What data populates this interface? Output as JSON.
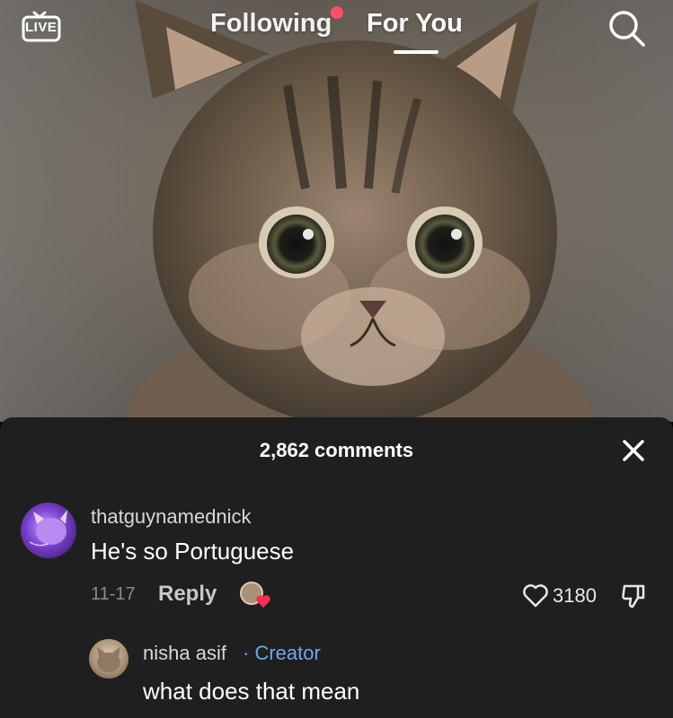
{
  "top_nav": {
    "live_label": "LIVE",
    "tabs": [
      {
        "label": "Following",
        "has_notification_dot": true
      },
      {
        "label": "For You",
        "active": true
      }
    ],
    "search_icon": "search-icon"
  },
  "comments_sheet": {
    "title": "2,862 comments",
    "close_icon": "close-icon",
    "comments": [
      {
        "username": "thatguynamednick",
        "text": "He's so Portuguese",
        "date": "11-17",
        "reply_label": "Reply",
        "like_count": "3180",
        "liked_by_creator": true
      },
      {
        "username": "nisha asif",
        "badge": "· Creator",
        "text": "what does that mean"
      }
    ]
  },
  "colors": {
    "sheet_background": "#1f1f1f",
    "notification_dot": "#fe4f6b",
    "creator_badge": "#6fa8e8",
    "creator_heart": "#fe2c55"
  }
}
